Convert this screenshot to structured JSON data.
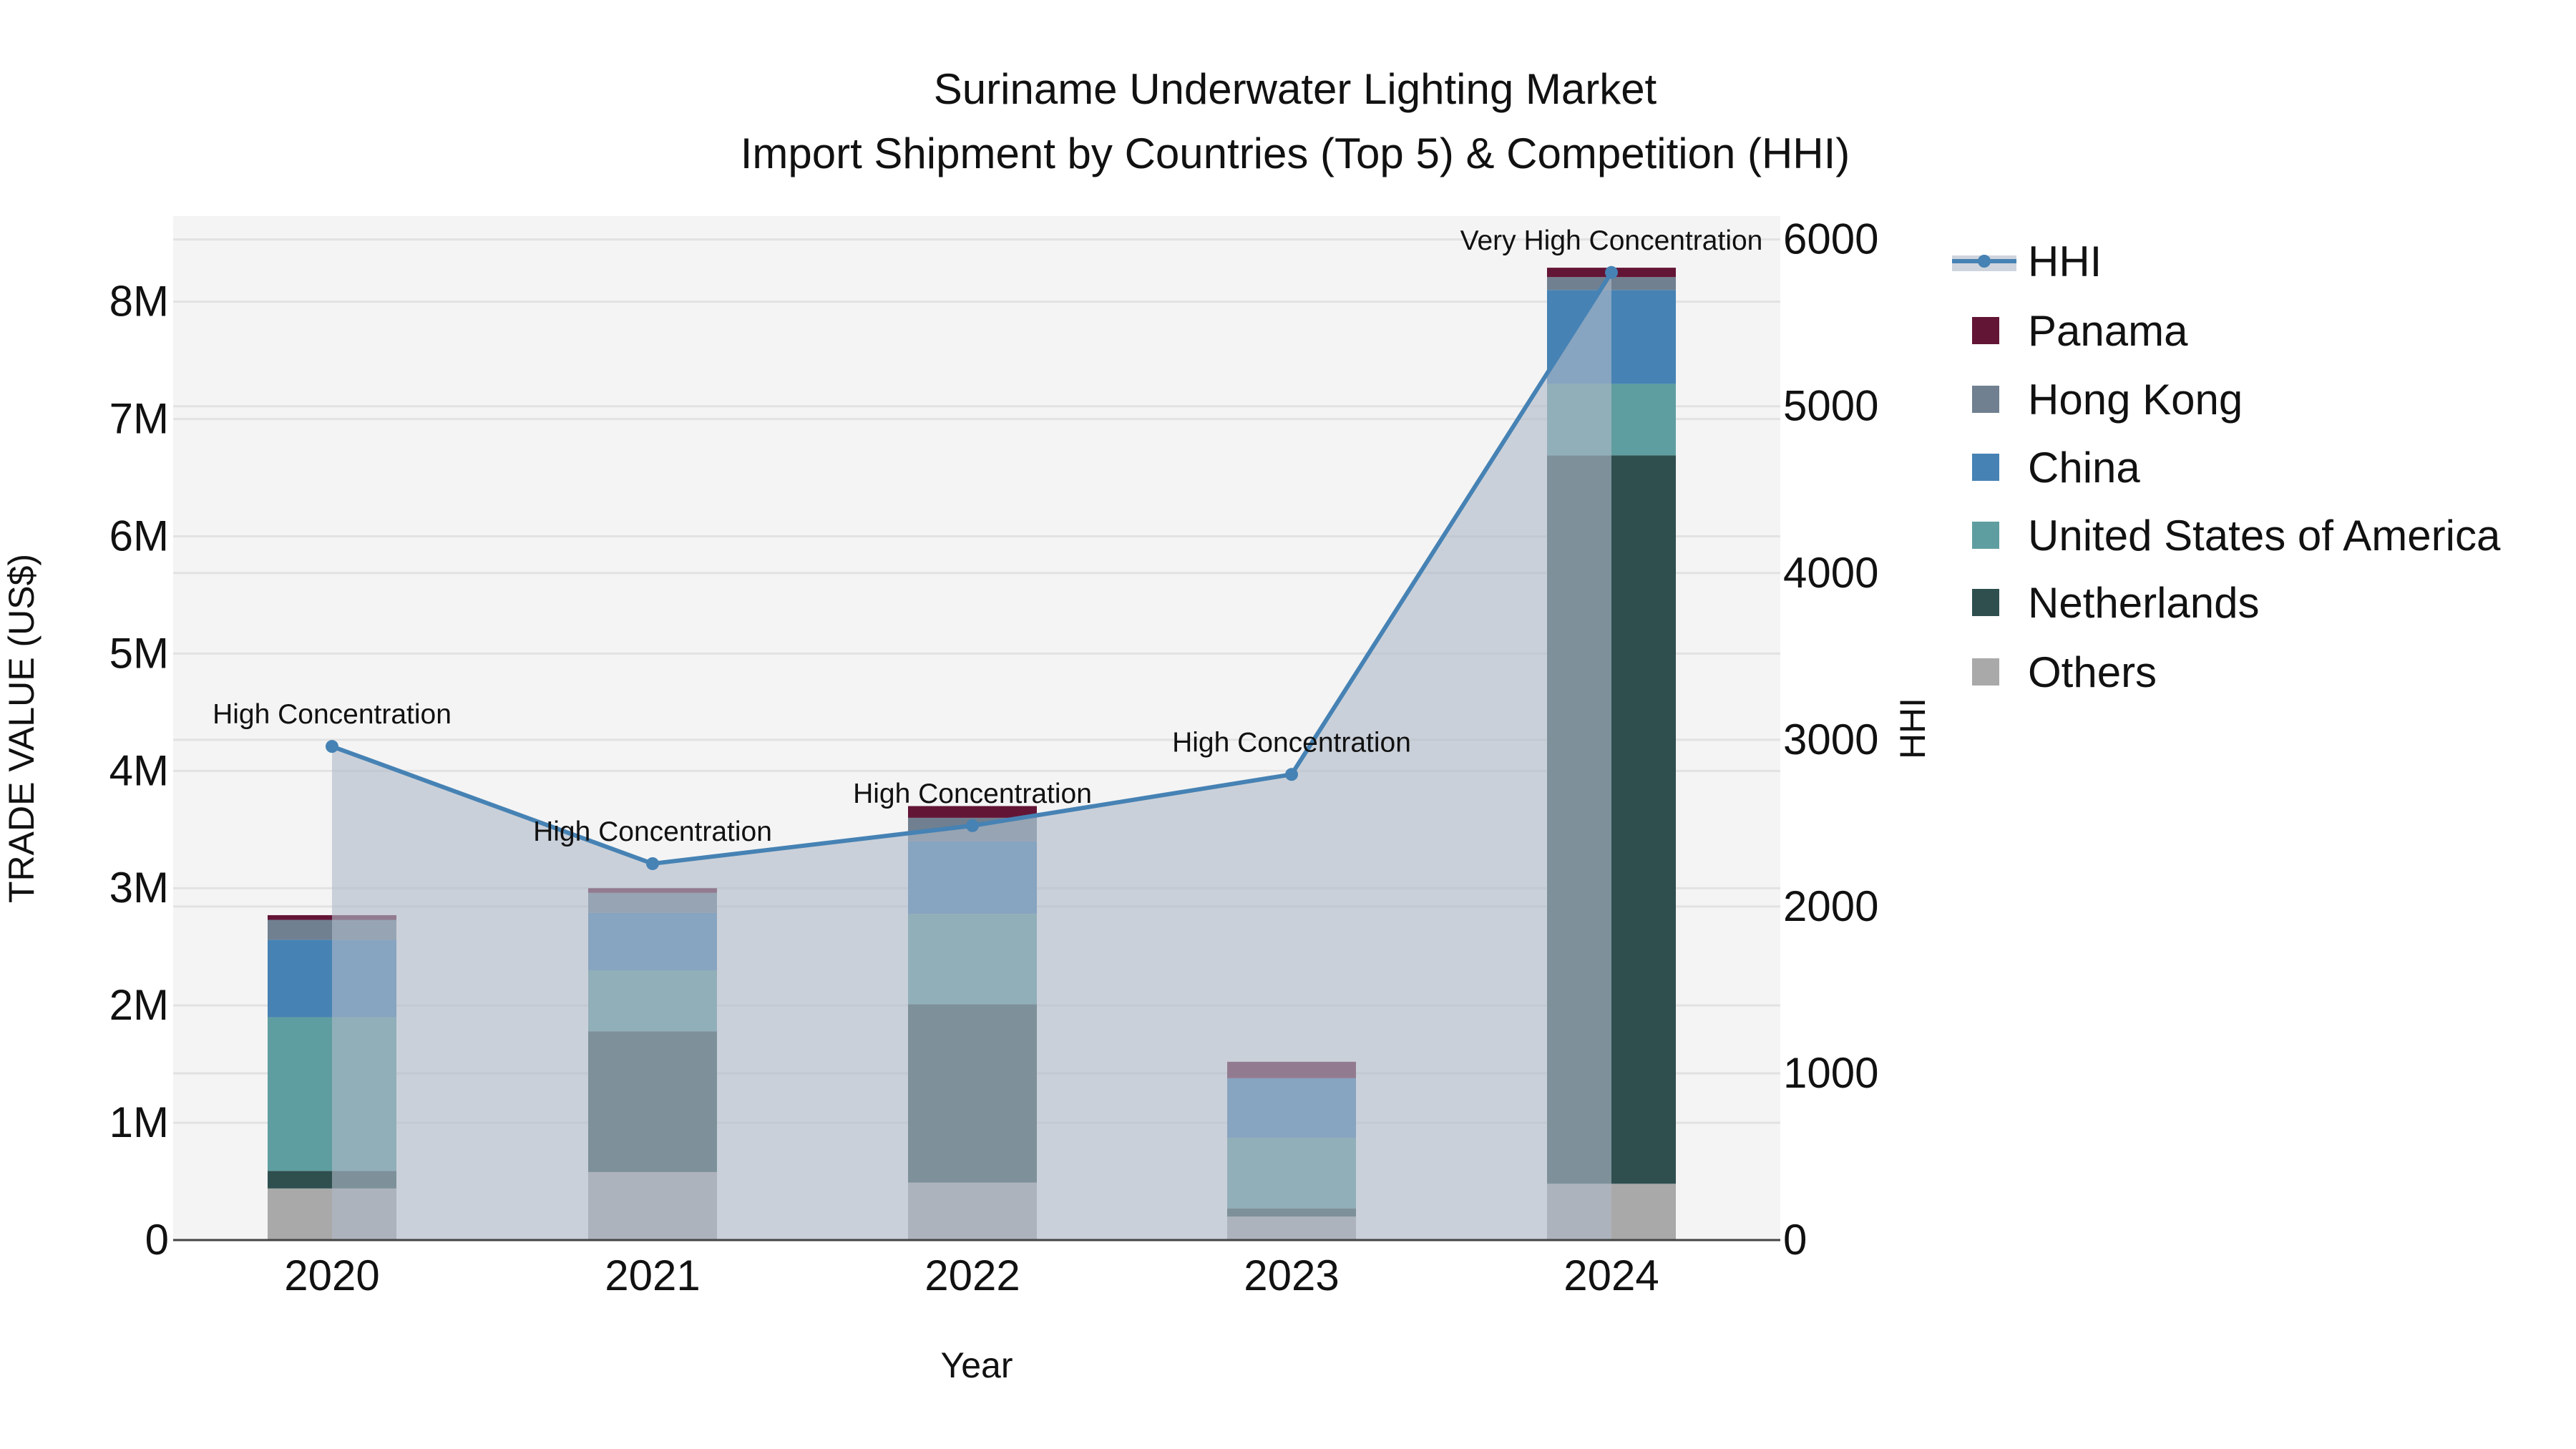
{
  "chart_data": {
    "type": "bar",
    "title": "Suriname Underwater Lighting Market",
    "subtitle": "Import Shipment by Countries (Top 5) & Competition (HHI)",
    "xlabel": "Year",
    "ylabel": "TRADE VALUE (US$)",
    "y2label": "HHI",
    "categories": [
      "2020",
      "2021",
      "2022",
      "2023",
      "2024"
    ],
    "stacked": true,
    "ylim": [
      0,
      8730000
    ],
    "y2lim": [
      0,
      6140
    ],
    "yticks": [
      0,
      1000000,
      2000000,
      3000000,
      4000000,
      5000000,
      6000000,
      7000000,
      8000000
    ],
    "ytick_labels": [
      "0",
      "1M",
      "2M",
      "3M",
      "4M",
      "5M",
      "6M",
      "7M",
      "8M"
    ],
    "y2ticks": [
      0,
      1000,
      2000,
      3000,
      4000,
      5000,
      6000
    ],
    "y2tick_labels": [
      "0",
      "1000",
      "2000",
      "3000",
      "4000",
      "5000",
      "6000"
    ],
    "grid": true,
    "legend_placement": "right",
    "series": [
      {
        "name": "Others",
        "color": "#a9a9a9",
        "values": [
          440000,
          580000,
          490000,
          200000,
          480000
        ]
      },
      {
        "name": "Netherlands",
        "color": "#2f4f4f",
        "values": [
          150000,
          1200000,
          1520000,
          70000,
          6210000
        ]
      },
      {
        "name": "United States of America",
        "color": "#5f9ea0",
        "values": [
          1310000,
          520000,
          770000,
          600000,
          610000
        ]
      },
      {
        "name": "China",
        "color": "#4682b4",
        "values": [
          660000,
          490000,
          620000,
          510000,
          800000
        ]
      },
      {
        "name": "Hong Kong",
        "color": "#708090",
        "values": [
          170000,
          170000,
          200000,
          0,
          110000
        ]
      },
      {
        "name": "Panama",
        "color": "#631536",
        "values": [
          40000,
          40000,
          100000,
          140000,
          80000
        ]
      }
    ],
    "line": {
      "name": "HHI",
      "color": "#4682b4",
      "axis": "right",
      "values": [
        2960,
        2257,
        2485,
        2792,
        5802
      ],
      "annotations": [
        "High Concentration",
        "High Concentration",
        "High Concentration",
        "High Concentration",
        "Very High Concentration"
      ]
    },
    "legend_order": [
      "HHI",
      "Panama",
      "Hong Kong",
      "China",
      "United States of America",
      "Netherlands",
      "Others"
    ]
  }
}
